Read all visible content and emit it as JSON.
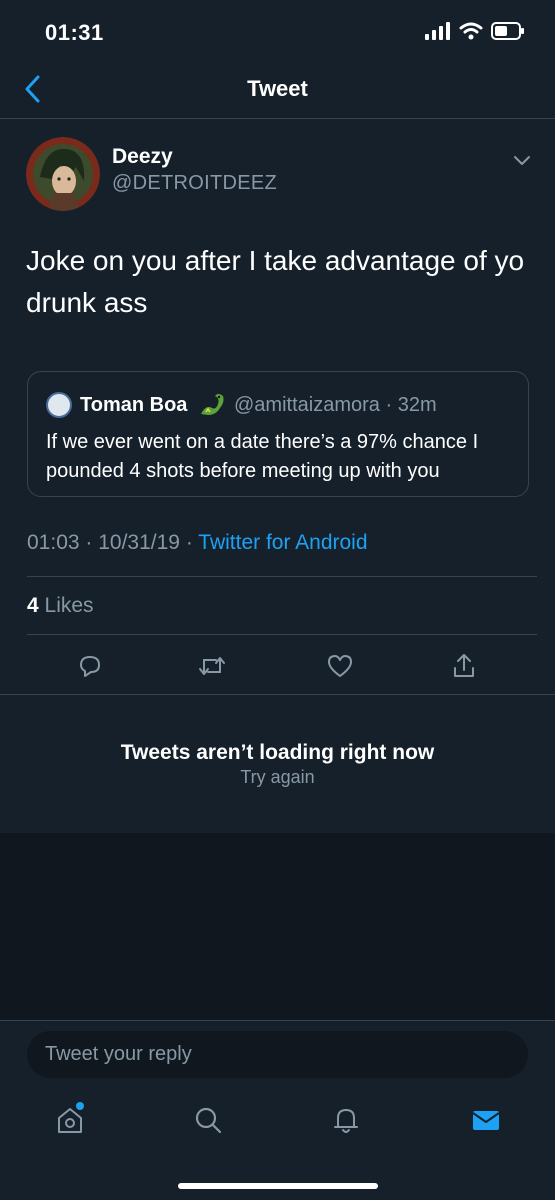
{
  "status_bar": {
    "time": "01:31"
  },
  "nav": {
    "title": "Tweet",
    "back_icon": "chevron-left-icon"
  },
  "tweet": {
    "author_name": "Deezy",
    "author_handle": "@DETROITDEEZ",
    "text": "Joke on you after I take advantage of yo drunk ass",
    "time": "01:03",
    "date": "10/31/19",
    "source": "Twitter for Android",
    "likes_count": "4",
    "likes_label": "Likes"
  },
  "quoted": {
    "author_name": "Toman Boa",
    "author_handle": "@amittaizamora",
    "age": "32m",
    "text": "If we ever went on a date there’s a 97% chance I pounded 4 shots before meeting up with you"
  },
  "replies_error": {
    "title": "Tweets aren’t loading right now",
    "retry_label": "Try again"
  },
  "reply_box": {
    "placeholder": "Tweet your reply"
  },
  "colors": {
    "background": "#15202b",
    "accent": "#1da1f2",
    "muted": "#8899a6",
    "divider": "#38444d"
  }
}
